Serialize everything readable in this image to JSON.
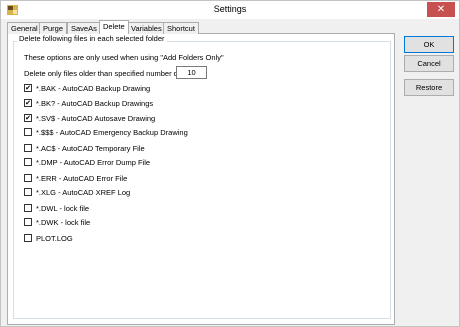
{
  "window": {
    "title": "Settings",
    "close_glyph": "✕",
    "accent": "#c75050"
  },
  "tabs": [
    {
      "label": "General"
    },
    {
      "label": "Purge"
    },
    {
      "label": "SaveAs"
    },
    {
      "label": "Delete",
      "active": true
    },
    {
      "label": "Variables"
    },
    {
      "label": "Shortcut"
    }
  ],
  "group": {
    "caption": "Delete following files in each selected folder",
    "note": "These options are only used when using \"Add Folders Only\"",
    "days_label": "Delete only files older than specified number days",
    "days_value": "10"
  },
  "options": [
    {
      "label": "*.BAK - AutoCAD Backup Drawing",
      "checked": true
    },
    {
      "label": "*.BK? - AutoCAD Backup Drawings",
      "checked": true
    },
    {
      "label": "*.SV$ - AutoCAD Autosave Drawing",
      "checked": true
    },
    {
      "label": "*.$$$ - AutoCAD Emergency Backup Drawing",
      "checked": false
    },
    {
      "label": "*.AC$ - AutoCAD Temporary File",
      "checked": false
    },
    {
      "label": "*.DMP - AutoCAD Error Dump File",
      "checked": false
    },
    {
      "label": "*.ERR - AutoCAD Error File",
      "checked": false
    },
    {
      "label": "*.XLG - AutoCAD XREF Log",
      "checked": false
    },
    {
      "label": "*.DWL - lock file",
      "checked": false
    },
    {
      "label": "*.DWK - lock file",
      "checked": false
    },
    {
      "label": "PLOT.LOG",
      "checked": false
    }
  ],
  "buttons": {
    "ok": "OK",
    "cancel": "Cancel",
    "restore": "Restore"
  }
}
